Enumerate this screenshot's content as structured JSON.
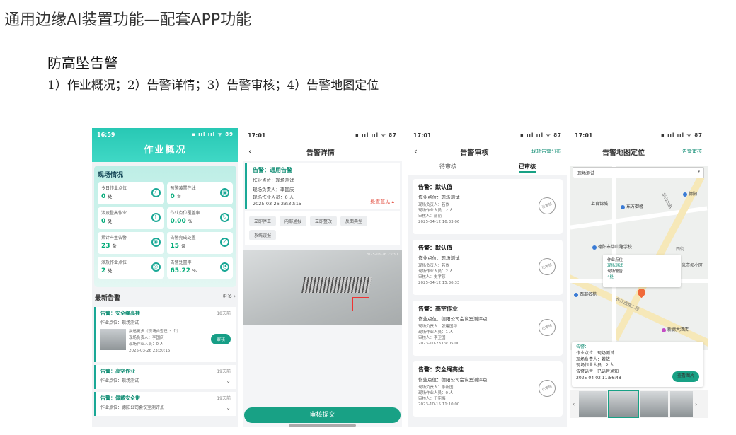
{
  "slide": {
    "title": "通用边缘AI装置功能—配套APP功能",
    "section_title": "防高坠告警",
    "section_sub": "1）作业概况；2）告警详情；3）告警审核；4）告警地图定位"
  },
  "phone1": {
    "time": "16:59",
    "status_icons": "▪ ııl ııl ᯤ 89",
    "title": "作业概况",
    "site_title": "现场情况",
    "metrics": [
      {
        "label": "今日作业点位",
        "value": "0",
        "unit": "处",
        "icon": "tower-icon"
      },
      {
        "label": "预警装置在线",
        "value": "0",
        "unit": "台",
        "icon": "device-icon"
      },
      {
        "label": "涉及登高作业",
        "value": "0",
        "unit": "处",
        "icon": "climb-icon"
      },
      {
        "label": "作业点位覆盖率",
        "value": "0.00",
        "unit": "%",
        "icon": "refresh-icon"
      },
      {
        "label": "累计产生告警",
        "value": "23",
        "unit": "条",
        "icon": "bell-icon"
      },
      {
        "label": "告警完成处置",
        "value": "15",
        "unit": "条",
        "icon": "check-icon"
      },
      {
        "label": "涉及作业点位",
        "value": "2",
        "unit": "处",
        "icon": "location-icon"
      },
      {
        "label": "告警处置率",
        "value": "65.22",
        "unit": "%",
        "icon": "pie-icon"
      }
    ],
    "latest_title": "最新告警",
    "more": "更多 ›",
    "alarms": [
      {
        "title": "告警：安全绳高挂",
        "ago": "18天前",
        "place": "作业点位：现场测试",
        "lines": [
          "描述更多（现场自查已 3 个）",
          "现场负责人：李国庆",
          "现场作业人员：0 人",
          "2025-03-26 23:30:15"
        ],
        "action": "审核"
      },
      {
        "title": "告警：高空作业",
        "ago": "19天前",
        "place": "作业点位：现场测试"
      },
      {
        "title": "告警：佩戴安全带",
        "ago": "19天前",
        "place": "作业点位：德阳公司会议室测评点"
      }
    ]
  },
  "phone2": {
    "time": "17:01",
    "status_icons": "▪ ııl ııl ᯤ 87",
    "title": "告警详情",
    "card": {
      "title": "告警：通用告警",
      "place": "作业点位：现场测试",
      "leader": "现场负责人：李国庆",
      "staff": "现场作业人员：0 人",
      "time": "2025-03-26 23:30:15",
      "dispose": "处置意见 ▴"
    },
    "actions": [
      "立即停工",
      "内部通报",
      "立即整改",
      "反面典型",
      "系统误报"
    ],
    "video_ts": "2025-03-26 23:30",
    "submit": "审核提交"
  },
  "phone3": {
    "time": "17:01",
    "status_icons": "▪ ııl ııl ᯤ 87",
    "title": "告警审核",
    "right": "现场告警分布",
    "tabs": [
      "待审核",
      "已审核"
    ],
    "cards": [
      {
        "title": "告警：默认值",
        "place": "作业点位：现场测试",
        "lines": [
          "现场负责人：若依",
          "现场作业人员：2 人",
          "审核人：丽丽",
          "2025-04-12 16:33:06"
        ]
      },
      {
        "title": "告警：默认值",
        "place": "作业点位：现场测试",
        "lines": [
          "现场负责人：若依",
          "现场作业人员：2 人",
          "审核人：史孝慈",
          "2025-04-12 15:36:33"
        ]
      },
      {
        "title": "告警：高空作业",
        "place": "作业点位：德阳公司会议室测评点",
        "lines": [
          "现场负责人：张建国华",
          "现场作业人员：1 人",
          "审核人：李卫国",
          "2023-10-23 09:05:00"
        ]
      },
      {
        "title": "告警：安全绳高挂",
        "place": "作业点位：德阳公司会议室测评点",
        "lines": [
          "现场负责人：李新国",
          "现场作业人员：0 人",
          "审核人：王宪梅",
          "2023-10-15 11:10:00"
        ]
      }
    ],
    "stamp": "已审核"
  },
  "phone4": {
    "time": "17:01",
    "status_icons": "▪ ııl ııl ᯤ 87",
    "title": "告警地图定位",
    "right": "告警审核",
    "dropdown": "现场测试",
    "pois": [
      "上官锦城",
      "东方御馨",
      "德阳",
      "德阳市华山路学校",
      "西街",
      "米市坝小区",
      "西部名苑",
      "新德大酒店",
      "长江西路二段",
      "华山北路"
    ],
    "popup": {
      "l1": "作业点位",
      "l2": "现场测试",
      "l3": "现场警告",
      "l4": "4处"
    },
    "info": {
      "head": "告警：",
      "place": "作业点位：现场测试",
      "leader": "现场负责人：若依",
      "staff": "现场作业人员：2 人",
      "voice": "告警语音：已语音通知",
      "time": "2025-04-02 11:56:48",
      "button": "查看图片"
    }
  }
}
